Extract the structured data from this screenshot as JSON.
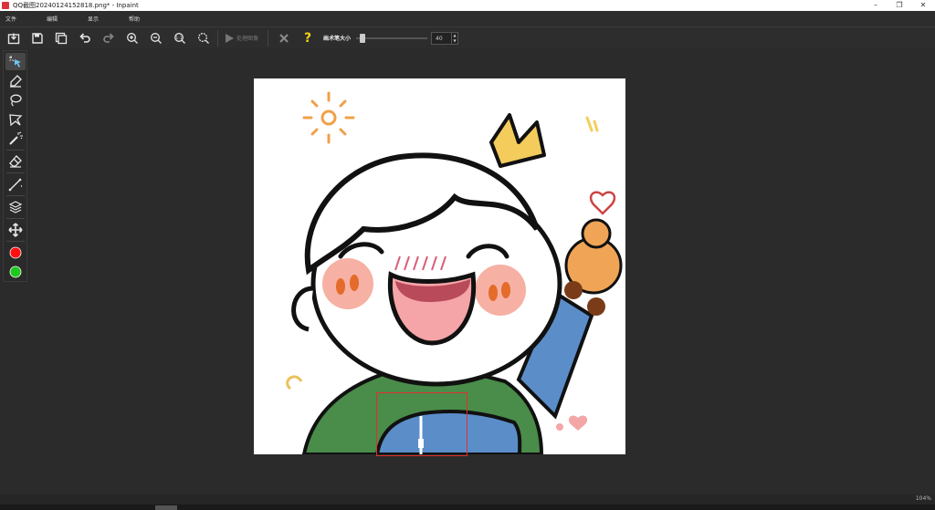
{
  "window": {
    "title": "QQ截图20240124152818.png* - Inpaint",
    "minimize": "–",
    "maximize": "❐",
    "close": "✕"
  },
  "menu": [
    "文件",
    "编辑",
    "显示",
    "帮助"
  ],
  "toolbar": {
    "process_label": "处理图像",
    "brush_size_label": "画术笔大小",
    "brush_size_value": "40",
    "brush_size_fraction": 0.05,
    "help_symbol": "?"
  },
  "tools": [
    {
      "name": "smart-select-tool",
      "icon": "magic-cursor-icon",
      "active": true
    },
    {
      "name": "marker-tool",
      "icon": "marker-icon",
      "active": false
    },
    {
      "name": "lasso-tool",
      "icon": "lasso-icon",
      "active": false
    },
    {
      "name": "polygon-lasso-tool",
      "icon": "polygon-lasso-icon",
      "active": false
    },
    {
      "name": "magic-wand-tool",
      "icon": "magic-wand-icon",
      "active": false
    },
    {
      "name": "eraser-tool",
      "icon": "eraser-icon",
      "active": false
    },
    {
      "name": "line-tool",
      "icon": "line-icon",
      "active": false
    },
    {
      "name": "layers-tool",
      "icon": "layers-icon",
      "active": false
    },
    {
      "name": "move-tool",
      "icon": "move-icon",
      "active": false
    },
    {
      "name": "red-color-tool",
      "icon": "red-dot-icon",
      "active": false
    },
    {
      "name": "green-color-tool",
      "icon": "green-dot-icon",
      "active": false
    }
  ],
  "colors": {
    "accent_red": "#e03030",
    "dot_red": "#ff1010",
    "dot_green": "#1ec81e",
    "help_yellow": "#f2d21a"
  },
  "status": {
    "zoom": "104%"
  }
}
